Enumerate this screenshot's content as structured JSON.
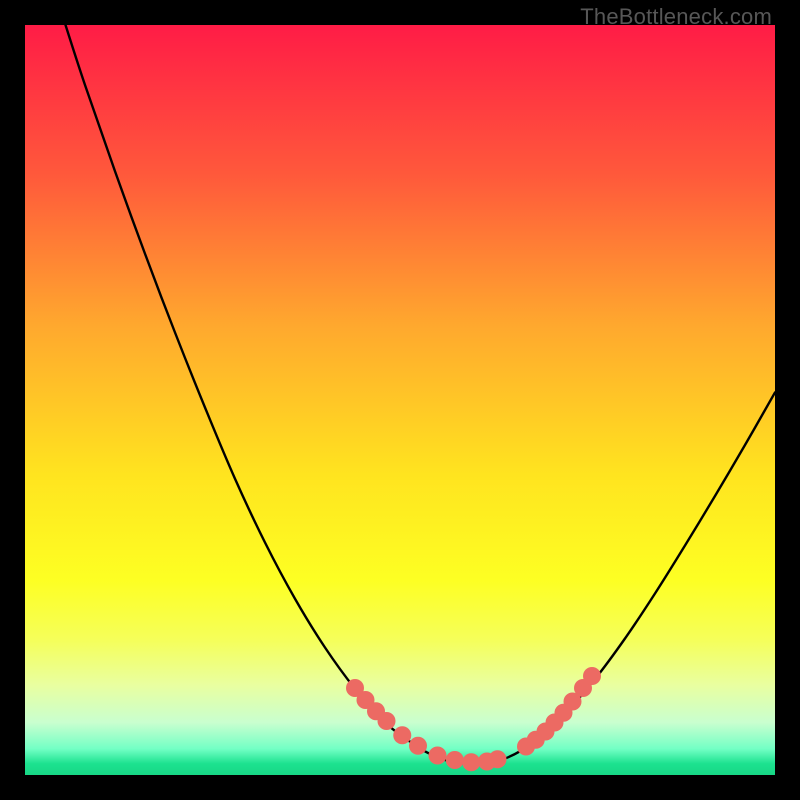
{
  "watermark": "TheBottleneck.com",
  "chart_data": {
    "type": "line",
    "title": "",
    "xlabel": "",
    "ylabel": "",
    "xlim": [
      0,
      100
    ],
    "ylim": [
      0,
      100
    ],
    "grid": false,
    "legend": false,
    "gradient_stops": [
      {
        "offset": 0,
        "color": "#ff1c46"
      },
      {
        "offset": 0.2,
        "color": "#ff593b"
      },
      {
        "offset": 0.4,
        "color": "#ffa82e"
      },
      {
        "offset": 0.6,
        "color": "#ffe41f"
      },
      {
        "offset": 0.74,
        "color": "#fdff23"
      },
      {
        "offset": 0.82,
        "color": "#f5ff5a"
      },
      {
        "offset": 0.88,
        "color": "#e9ffa0"
      },
      {
        "offset": 0.93,
        "color": "#c9ffcf"
      },
      {
        "offset": 0.965,
        "color": "#73ffc5"
      },
      {
        "offset": 0.985,
        "color": "#1ce28f"
      },
      {
        "offset": 1.0,
        "color": "#18d786"
      }
    ],
    "series": [
      {
        "name": "curve",
        "x": [
          5.4,
          8,
          12,
          16,
          20,
          24,
          28,
          32,
          36,
          40,
          44,
          48,
          52,
          54,
          56,
          58,
          60,
          64,
          68,
          72,
          76,
          80,
          84,
          88,
          92,
          96,
          100
        ],
        "y": [
          100,
          92,
          80.5,
          69.5,
          59,
          49,
          39.5,
          31,
          23.5,
          17,
          11.5,
          7,
          4,
          2.8,
          2.0,
          1.6,
          1.5,
          2.2,
          4.5,
          8.2,
          12.8,
          18.2,
          24.2,
          30.6,
          37.2,
          44.0,
          51.0
        ]
      }
    ],
    "markers": {
      "name": "highlight-dots",
      "color": "#ec6a63",
      "radius_px": 9,
      "x": [
        44.0,
        45.4,
        46.8,
        48.2,
        50.3,
        52.4,
        55.0,
        57.3,
        59.5,
        61.6,
        63.0,
        66.8,
        68.1,
        69.4,
        70.6,
        71.8,
        73.0,
        74.4,
        75.6
      ],
      "y": [
        11.6,
        10.0,
        8.5,
        7.2,
        5.3,
        3.9,
        2.6,
        2.0,
        1.7,
        1.8,
        2.1,
        3.8,
        4.7,
        5.8,
        7.0,
        8.3,
        9.8,
        11.6,
        13.2
      ]
    }
  }
}
